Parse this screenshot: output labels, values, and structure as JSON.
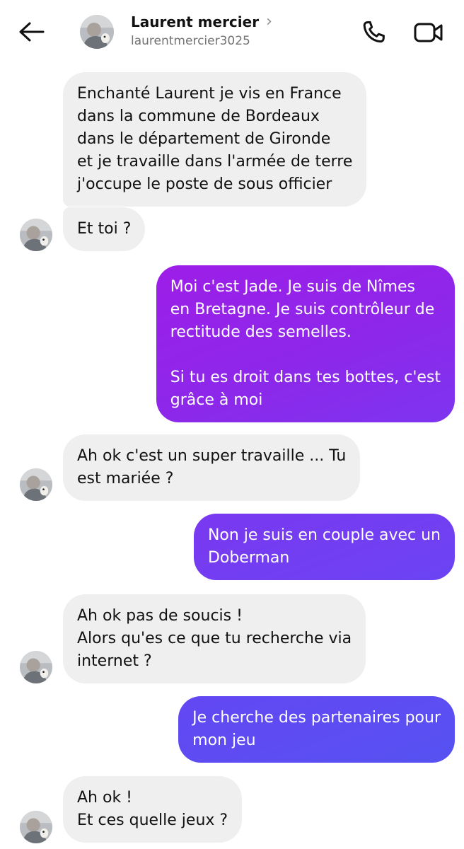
{
  "header": {
    "name": "Laurent mercier",
    "handle": "laurentmercier3025",
    "chevron": "›",
    "icons": {
      "back": "arrow-left-icon",
      "call": "phone-icon",
      "video": "video-camera-icon",
      "chevron": "chevron-right-icon"
    }
  },
  "messages": [
    {
      "from": "them",
      "text": "Enchanté Laurent je vis en France\ndans la commune de Bordeaux\ndans le département de Gironde\net je travaille dans l'armée de terre\nj'occupe le poste de sous officier"
    },
    {
      "from": "them",
      "text": "Et toi ?"
    },
    {
      "from": "me",
      "text": "Moi c'est Jade. Je suis de Nîmes\nen Bretagne. Je suis contrôleur de\nrectitude des semelles.\n\nSi tu es droit dans tes bottes,  c'est\ngrâce à moi"
    },
    {
      "from": "them",
      "text": "Ah ok c'est un super travaille ... Tu\nest mariée ?"
    },
    {
      "from": "me",
      "text": "Non je suis en couple avec un\nDoberman"
    },
    {
      "from": "them",
      "text": "Ah ok pas de soucis !\nAlors qu'es ce que tu recherche via\ninternet ?"
    },
    {
      "from": "me",
      "text": "Je cherche des partenaires pour\nmon jeu"
    },
    {
      "from": "them",
      "text": "Ah ok !\nEt ces quelle jeux ?"
    }
  ],
  "colors": {
    "incoming_bubble": "#efefef",
    "outgoing_purple": "#9a1fe6",
    "outgoing_violet": "#7a3cf0",
    "outgoing_blue": "#5b4ff2",
    "secondary_text": "#737373"
  }
}
